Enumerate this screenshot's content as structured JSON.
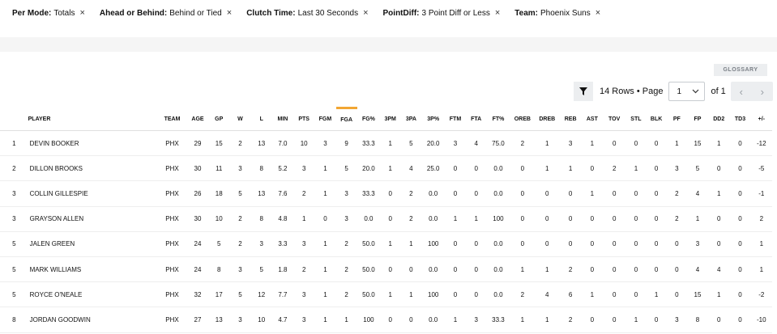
{
  "filters": [
    {
      "key": "Per Mode:",
      "value": "Totals"
    },
    {
      "key": "Ahead or Behind:",
      "value": "Behind or Tied"
    },
    {
      "key": "Clutch Time:",
      "value": "Last 30 Seconds"
    },
    {
      "key": "PointDiff:",
      "value": "3 Point Diff or Less"
    },
    {
      "key": "Team:",
      "value": "Phoenix Suns"
    }
  ],
  "close_glyph": "×",
  "glossary_label": "GLOSSARY",
  "pager": {
    "rows_text": "14 Rows • Page",
    "page_value": "1",
    "of_text": "of 1",
    "prev_glyph": "‹",
    "next_glyph": "›"
  },
  "columns": [
    "",
    "PLAYER",
    "TEAM",
    "AGE",
    "GP",
    "W",
    "L",
    "MIN",
    "PTS",
    "FGM",
    "FGA",
    "FG%",
    "3PM",
    "3PA",
    "3P%",
    "FTM",
    "FTA",
    "FT%",
    "OREB",
    "DREB",
    "REB",
    "AST",
    "TOV",
    "STL",
    "BLK",
    "PF",
    "FP",
    "DD2",
    "TD3",
    "+/-"
  ],
  "rows": [
    [
      "1",
      "DEVIN BOOKER",
      "PHX",
      "29",
      "15",
      "2",
      "13",
      "7.0",
      "10",
      "3",
      "9",
      "33.3",
      "1",
      "5",
      "20.0",
      "3",
      "4",
      "75.0",
      "2",
      "1",
      "3",
      "1",
      "0",
      "0",
      "0",
      "1",
      "15",
      "1",
      "0",
      "-12"
    ],
    [
      "2",
      "DILLON BROOKS",
      "PHX",
      "30",
      "11",
      "3",
      "8",
      "5.2",
      "3",
      "1",
      "5",
      "20.0",
      "1",
      "4",
      "25.0",
      "0",
      "0",
      "0.0",
      "0",
      "1",
      "1",
      "0",
      "2",
      "1",
      "0",
      "3",
      "5",
      "0",
      "0",
      "-5"
    ],
    [
      "3",
      "COLLIN GILLESPIE",
      "PHX",
      "26",
      "18",
      "5",
      "13",
      "7.6",
      "2",
      "1",
      "3",
      "33.3",
      "0",
      "2",
      "0.0",
      "0",
      "0",
      "0.0",
      "0",
      "0",
      "0",
      "1",
      "0",
      "0",
      "0",
      "2",
      "4",
      "1",
      "0",
      "-1"
    ],
    [
      "3",
      "GRAYSON ALLEN",
      "PHX",
      "30",
      "10",
      "2",
      "8",
      "4.8",
      "1",
      "0",
      "3",
      "0.0",
      "0",
      "2",
      "0.0",
      "1",
      "1",
      "100",
      "0",
      "0",
      "0",
      "0",
      "0",
      "0",
      "0",
      "2",
      "1",
      "0",
      "0",
      "2"
    ],
    [
      "5",
      "JALEN GREEN",
      "PHX",
      "24",
      "5",
      "2",
      "3",
      "3.3",
      "3",
      "1",
      "2",
      "50.0",
      "1",
      "1",
      "100",
      "0",
      "0",
      "0.0",
      "0",
      "0",
      "0",
      "0",
      "0",
      "0",
      "0",
      "0",
      "3",
      "0",
      "0",
      "1"
    ],
    [
      "5",
      "MARK WILLIAMS",
      "PHX",
      "24",
      "8",
      "3",
      "5",
      "1.8",
      "2",
      "1",
      "2",
      "50.0",
      "0",
      "0",
      "0.0",
      "0",
      "0",
      "0.0",
      "1",
      "1",
      "2",
      "0",
      "0",
      "0",
      "0",
      "0",
      "4",
      "4",
      "0",
      "1"
    ],
    [
      "5",
      "ROYCE O'NEALE",
      "PHX",
      "32",
      "17",
      "5",
      "12",
      "7.7",
      "3",
      "1",
      "2",
      "50.0",
      "1",
      "1",
      "100",
      "0",
      "0",
      "0.0",
      "2",
      "4",
      "6",
      "1",
      "0",
      "0",
      "1",
      "0",
      "15",
      "1",
      "0",
      "-2"
    ],
    [
      "8",
      "JORDAN GOODWIN",
      "PHX",
      "27",
      "13",
      "3",
      "10",
      "4.7",
      "3",
      "1",
      "1",
      "100",
      "0",
      "0",
      "0.0",
      "1",
      "3",
      "33.3",
      "1",
      "1",
      "2",
      "0",
      "0",
      "1",
      "0",
      "3",
      "8",
      "0",
      "0",
      "-10"
    ]
  ],
  "colors": {
    "link": "#1d5aa8",
    "sort_accent": "#f2a633"
  }
}
